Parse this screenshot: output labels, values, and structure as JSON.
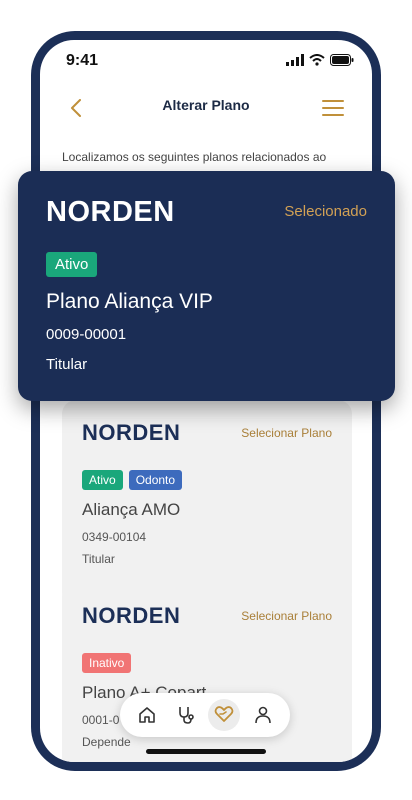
{
  "status_bar": {
    "time": "9:41"
  },
  "header": {
    "title": "Alterar Plano"
  },
  "intro_text": "Localizamos os seguintes planos relacionados ao",
  "selected_plan": {
    "brand": "NORDEN",
    "status_label": "Selecionado",
    "badge": "Ativo",
    "name": "Plano Aliança VIP",
    "number": "0009-00001",
    "role": "Titular"
  },
  "plans": [
    {
      "brand": "NORDEN",
      "action": "Selecionar Plano",
      "badges": [
        "Ativo",
        "Odonto"
      ],
      "name": "Aliança AMO",
      "number": "0349-00104",
      "role": "Titular"
    },
    {
      "brand": "NORDEN",
      "action": "Selecionar Plano",
      "badges": [
        "Inativo"
      ],
      "name": "Plano A+ Copart",
      "number": "0001-0",
      "role": "Depende"
    }
  ],
  "nav": {
    "items": [
      "home-icon",
      "stethoscope-icon",
      "heart-hand-icon",
      "profile-icon"
    ],
    "active": "heart-hand-icon"
  },
  "colors": {
    "phone_frame": "#1c2f57",
    "selected_card": "#1b2d55",
    "accent_gold": "#c0903a",
    "badge_active": "#1aa77b",
    "badge_odonto": "#3d6bbd",
    "badge_inactive": "#f17474"
  }
}
